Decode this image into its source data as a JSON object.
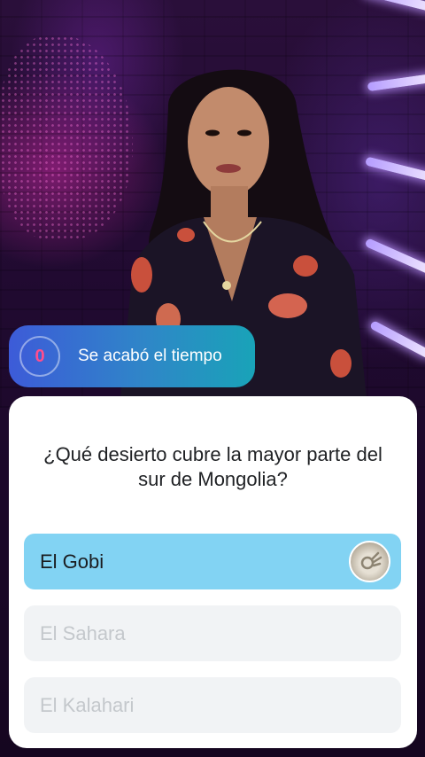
{
  "timer": {
    "value": "0",
    "message": "Se acabó el tiempo"
  },
  "question": {
    "text": "¿Qué desierto cubre la mayor parte del sur de Mongolia?"
  },
  "answers": [
    {
      "label": "El Gobi",
      "selected": true,
      "avatar_icon": "ok-hand-avatar-icon"
    },
    {
      "label": "El Sahara",
      "selected": false
    },
    {
      "label": "El Kalahari",
      "selected": false
    }
  ],
  "colors": {
    "timer_gradient_start": "#3d5bd8",
    "timer_gradient_end": "#19a3b8",
    "timer_number": "#ff4d8d",
    "selected_answer": "#82d3f3",
    "unselected_answer": "#f1f3f5",
    "disabled_text": "#c4c8cc"
  }
}
